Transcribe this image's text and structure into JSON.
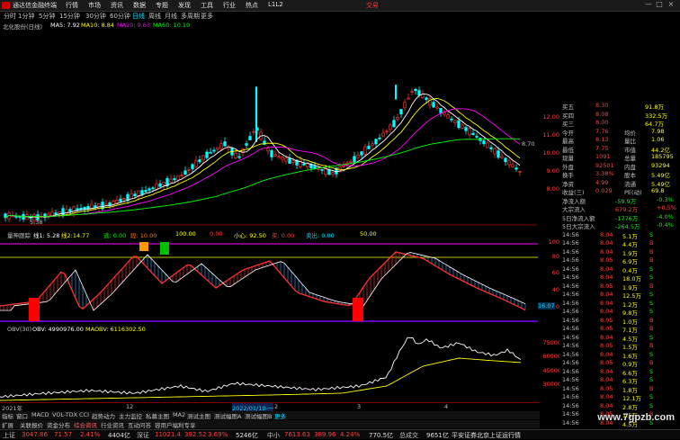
{
  "window": {
    "app_title": "通达信金融终端",
    "menu": [
      "行情",
      "市场",
      "资讯",
      "数据",
      "专题",
      "发现",
      "工具",
      "行业",
      "热点",
      "L1L2"
    ],
    "trade_label": "交易",
    "controls": [
      "—",
      "□",
      "×"
    ]
  },
  "periods": {
    "items": [
      "分时",
      "1分钟",
      "5分钟",
      "15分钟",
      "30分钟",
      "60分钟",
      "日线",
      "周线",
      "月线",
      "多周期"
    ],
    "more": "更多",
    "selected_index": 6
  },
  "ma_legend": {
    "name": "北化股份(日线)",
    "ma5": "MA5: 7.92",
    "ma10": "MA10: 8.84",
    "ma20": "MA20: 9.63",
    "ma60": "MA60: 10.10",
    "colors": {
      "ma5": "#ffffff",
      "ma10": "#ffff00",
      "ma20": "#ff00ff",
      "ma60": "#00ff00"
    }
  },
  "main_chart": {
    "y_ticks": [
      "12.00",
      "11.00",
      "10.00",
      "9.00",
      "8.00"
    ],
    "high_marker": "8.70",
    "low_marker": "5.38",
    "low_marker_right": "7.76"
  },
  "indicator1": {
    "label": "量神跟踪",
    "values": [
      "线1: 5.28",
      "线2:14.77",
      "逃: 0.00",
      "段: 10.00",
      "100.00",
      "0.00",
      "小心: 92.50",
      "买: 0.00",
      "卖出: 0.00",
      "50.00"
    ],
    "tags": [
      "卖出",
      "底部",
      "买",
      "卖",
      "逃跑",
      "买"
    ],
    "y_ticks": [
      "100",
      "80",
      "60",
      "40",
      "20"
    ],
    "current": "16.07"
  },
  "indicator2": {
    "label": "OBV(30)",
    "obv": "OBV: 4990976.00",
    "maobv": "MAOBV: 6116302.50",
    "y_ticks": [
      "75000",
      "60000",
      "45000",
      "30000"
    ]
  },
  "dates": [
    "2021年",
    "12",
    "2022/01/10-一",
    "2",
    "3",
    "4"
  ],
  "tabs": [
    "指标",
    "窗口",
    "MACD",
    "VOL-TDX",
    "CCI",
    "趋势动力",
    "主力监控",
    "私募主图",
    "MA2",
    "测试主图",
    "测试幅图A",
    "测试幅图B",
    "更多"
  ],
  "tabs2": [
    "扩展",
    "关联报价",
    "资金分布",
    "综合资讯",
    "行业资讯",
    "互动问答",
    "容用户福利专享"
  ],
  "quote_panel": {
    "rows": [
      {
        "label": "买五",
        "price": "8.30",
        "vol": "91.8万"
      },
      {
        "label": "买四",
        "price": "8.08",
        "vol": "332.5万"
      },
      {
        "label": "买三",
        "price": "8.00",
        "vol": "64.7万"
      },
      {
        "label": "今开",
        "price": "7.76",
        "k2": "均价",
        "v2": "7.98"
      },
      {
        "label": "最高",
        "price": "8.13",
        "k2": "量比",
        "v2": "1.06"
      },
      {
        "label": "最低",
        "price": "7.75",
        "k2": "市值",
        "v2": "44.2亿"
      },
      {
        "label": "现量",
        "price": "1091",
        "k2": "总量",
        "v2": "185795"
      },
      {
        "label": "外盘",
        "price": "92501",
        "k2": "内盘",
        "v2": "93294"
      },
      {
        "label": "换手",
        "price": "3.38%",
        "k2": "股本",
        "v2": "5.49亿"
      },
      {
        "label": "净资",
        "price": "4.99",
        "k2": "流通",
        "v2": "5.49亿"
      },
      {
        "label": "收益(三)",
        "price": "0.029",
        "k2": "PE(动)",
        "v2": "69.8"
      }
    ],
    "flows": [
      {
        "label": "净流入额",
        "value": "-59.9万",
        "pct": "-0.3%"
      },
      {
        "label": "大宗流入",
        "value": "679.2万",
        "pct": "+0.5%"
      },
      {
        "label": "5日净流入额",
        "value": "-1776万",
        "pct": "-4.0%"
      },
      {
        "label": "5日大宗流入",
        "value": "-264.5万",
        "pct": "-0.4%"
      }
    ],
    "ticks": [
      {
        "t": "14:56",
        "p": "8.04",
        "v": "5.1万",
        "d": "S"
      },
      {
        "t": "14:56",
        "p": "8.04",
        "v": "4.4万",
        "d": "B"
      },
      {
        "t": "14:56",
        "p": "8.04",
        "v": "1.9万",
        "d": "B"
      },
      {
        "t": "14:56",
        "p": "8.05",
        "v": "6.9万",
        "d": "B"
      },
      {
        "t": "14:56",
        "p": "8.04",
        "v": "0.4万",
        "d": "S"
      },
      {
        "t": "14:56",
        "p": "8.04",
        "v": "18.0万",
        "d": "S"
      },
      {
        "t": "14:56",
        "p": "8.05",
        "v": "1.9万",
        "d": "B"
      },
      {
        "t": "14:56",
        "p": "8.04",
        "v": "12.5万",
        "d": "S"
      },
      {
        "t": "14:56",
        "p": "8.04",
        "v": "1.2万",
        "d": "S"
      },
      {
        "t": "14:56",
        "p": "8.04",
        "v": "9.8万",
        "d": "S"
      },
      {
        "t": "14:56",
        "p": "8.05",
        "v": "1.0万",
        "d": "B"
      },
      {
        "t": "14:56",
        "p": "8.05",
        "v": "7.1万",
        "d": "B"
      },
      {
        "t": "14:56",
        "p": "8.04",
        "v": "4.5万",
        "d": "S"
      },
      {
        "t": "14:56",
        "p": "8.05",
        "v": "1.5万",
        "d": "B"
      },
      {
        "t": "14:56",
        "p": "8.04",
        "v": "1.6万",
        "d": "S"
      },
      {
        "t": "14:56",
        "p": "8.05",
        "v": "0.9万",
        "d": "B"
      },
      {
        "t": "14:56",
        "p": "8.04",
        "v": "6.6万",
        "d": "S"
      },
      {
        "t": "14:56",
        "p": "8.04",
        "v": "6.3万",
        "d": "S"
      },
      {
        "t": "14:56",
        "p": "8.05",
        "v": "1.8万",
        "d": "B"
      },
      {
        "t": "14:56",
        "p": "8.04",
        "v": "12.1万",
        "d": "S"
      },
      {
        "t": "14:56",
        "p": "8.04",
        "v": "2.8万",
        "d": "S"
      },
      {
        "t": "14:56",
        "p": "8.05",
        "v": "1.5万",
        "d": "B"
      },
      {
        "t": "14:56",
        "p": "8.04",
        "v": "4.5万",
        "d": "S"
      }
    ]
  },
  "status": {
    "sh": {
      "name": "上证",
      "val": "3047.86",
      "chg": "71.57",
      "pct": "2.41%",
      "amt": "4404亿"
    },
    "sz": {
      "name": "深证",
      "val": "11021.4",
      "chg": "392.52",
      "pct": "3.69%",
      "amt": "5246亿"
    },
    "zx": {
      "name": "中小",
      "val": "7613.63",
      "chg": "389.96",
      "pct": "4.24%",
      "amt": "770.5亿"
    },
    "zs": {
      "name": "总成交",
      "val": "9651亿"
    },
    "ticker": "平安证券北京上证运行情",
    "watermark": "www.7gpzb.com"
  }
}
